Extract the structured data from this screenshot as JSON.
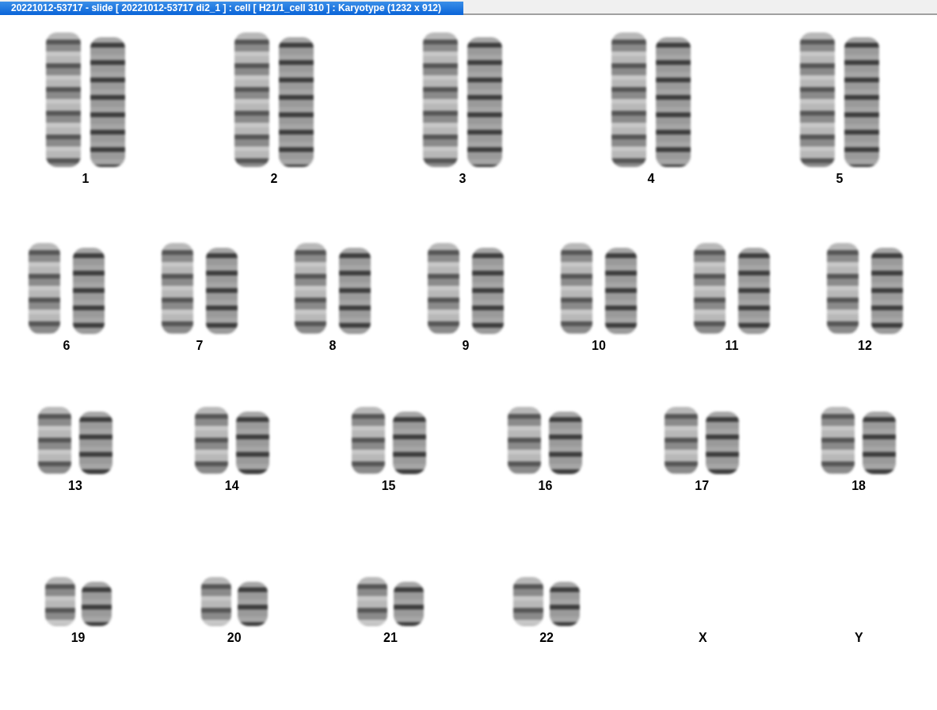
{
  "window": {
    "title": "20221012-53717 - slide [ 20221012-53717 di2_1 ] : cell [ H21/1_cell 310 ] : Karyotype  (1232 x 912)"
  },
  "karyotype": {
    "rows": [
      {
        "pairs": [
          {
            "label": "1",
            "kind": "pair"
          },
          {
            "label": "2",
            "kind": "pair"
          },
          {
            "label": "3",
            "kind": "pair"
          },
          {
            "label": "4",
            "kind": "pair"
          },
          {
            "label": "5",
            "kind": "pair"
          }
        ]
      },
      {
        "pairs": [
          {
            "label": "6",
            "kind": "pair"
          },
          {
            "label": "7",
            "kind": "pair"
          },
          {
            "label": "8",
            "kind": "pair"
          },
          {
            "label": "9",
            "kind": "pair"
          },
          {
            "label": "10",
            "kind": "pair"
          },
          {
            "label": "11",
            "kind": "pair"
          },
          {
            "label": "12",
            "kind": "pair"
          }
        ]
      },
      {
        "pairs": [
          {
            "label": "13",
            "kind": "pair"
          },
          {
            "label": "14",
            "kind": "pair"
          },
          {
            "label": "15",
            "kind": "pair"
          },
          {
            "label": "16",
            "kind": "pair"
          },
          {
            "label": "17",
            "kind": "pair"
          },
          {
            "label": "18",
            "kind": "pair"
          }
        ]
      },
      {
        "pairs": [
          {
            "label": "19",
            "kind": "pair"
          },
          {
            "label": "20",
            "kind": "pair"
          },
          {
            "label": "21",
            "kind": "pair"
          },
          {
            "label": "22",
            "kind": "pair"
          },
          {
            "label": "X",
            "kind": "blank"
          },
          {
            "label": "Y",
            "kind": "blank"
          }
        ]
      }
    ]
  }
}
